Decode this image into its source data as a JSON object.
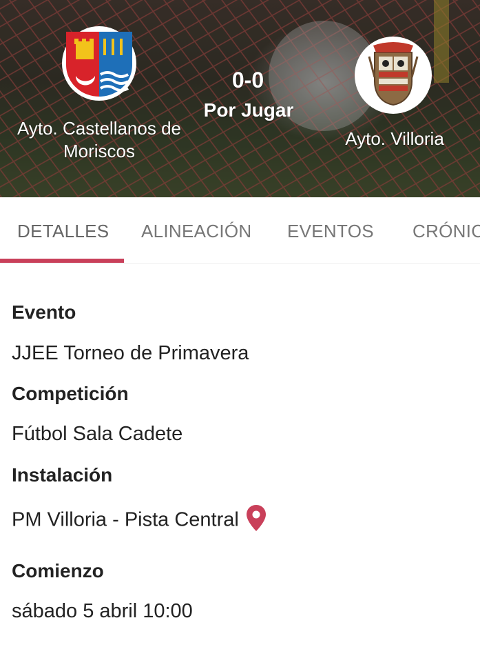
{
  "match": {
    "home_team": "Ayto. Castellanos de Moriscos",
    "away_team": "Ayto. Villoria",
    "score": "0-0",
    "status": "Por Jugar"
  },
  "tabs": [
    "DETALLES",
    "ALINEACIÓN",
    "EVENTOS",
    "CRÓNIC"
  ],
  "active_tab": "DETALLES",
  "details": {
    "evento_label": "Evento",
    "evento_value": "JJEE Torneo de Primavera",
    "competicion_label": "Competición",
    "competicion_value": "Fútbol Sala Cadete",
    "instalacion_label": "Instalación",
    "instalacion_value": "PM Villoria - Pista Central",
    "comienzo_label": "Comienzo",
    "comienzo_value": "sábado 5 abril 10:00"
  },
  "colors": {
    "accent": "#c9405a",
    "tab_text": "#777777",
    "text": "#222222"
  },
  "icons": {
    "location": "location-pin-icon"
  }
}
